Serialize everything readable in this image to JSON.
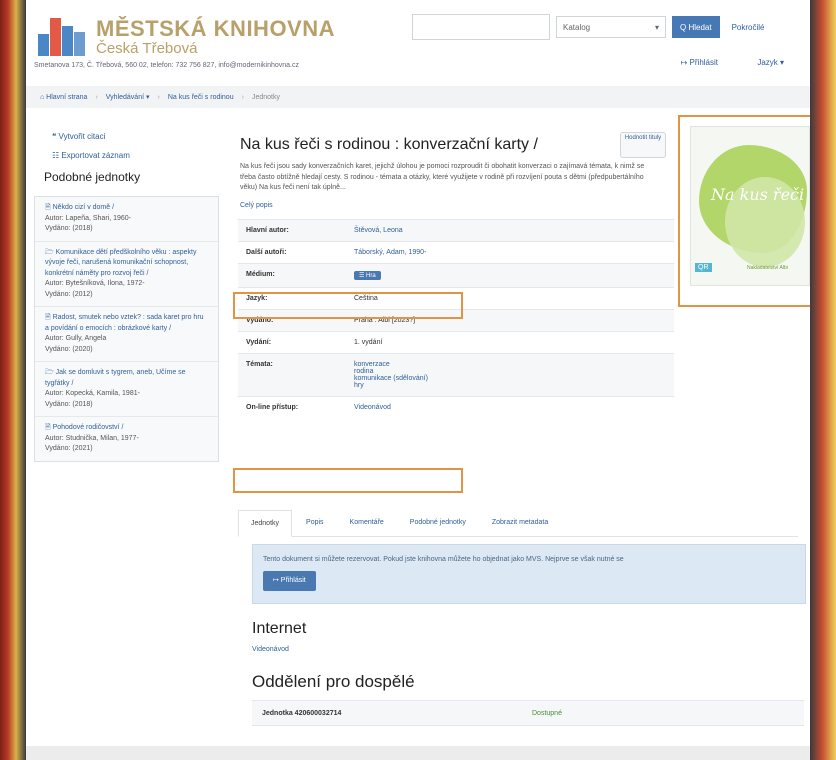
{
  "header": {
    "logo_title": "MĚSTSKÁ KNIHOVNA",
    "logo_subtitle": "Česká Třebová",
    "address": "Smetanova 173, Č. Třebová, 560 02, telefon: 732 756 827, info@modernikinhovna.cz",
    "search_placeholder": "",
    "search_type": "Katalog",
    "search_button": "Q Hledat",
    "advanced_link": "Pokročilé",
    "login_link": "↦ Přihlásit",
    "language_link": "Jazyk ▾"
  },
  "breadcrumb": {
    "home": "⌂ Hlavní strana",
    "search": "Vyhledávání ▾",
    "record": "Na kus řeči s rodinou",
    "current": "Jednotky"
  },
  "left_tools": {
    "cite": "❝ Vytvořit citaci",
    "export": "☷ Exportovat záznam",
    "similar_title": "Podobné jednotky"
  },
  "similar_items": [
    {
      "title": "🗎 Někdo cizí v domě /",
      "author": "Autor: Lapeña, Shari, 1960-",
      "released": "Vydáno: (2018)"
    },
    {
      "title": "🗁 Komunikace dětí předškolního věku : aspekty vývoje řeči, narušená komunikační schopnost, konkrétní náměty pro rozvoj řeči /",
      "author": "Autor: Bytešníková, Ilona, 1972-",
      "released": "Vydáno: (2012)"
    },
    {
      "title": "🗎 Radost, smutek nebo vztek? : sada karet pro hru a povídání o emocích : obrázkové karty /",
      "author": "Autor: Gully, Angela",
      "released": "Vydáno: (2020)"
    },
    {
      "title": "🗁 Jak se domluvit s tygrem, aneb, Učíme se tygřátky /",
      "author": "Autor: Kopecká, Kamila, 1981-",
      "released": "Vydáno: (2018)"
    },
    {
      "title": "🗎 Pohodové rodičovství /",
      "author": "Autor: Studnička, Milan, 1977-",
      "released": "Vydáno: (2021)"
    }
  ],
  "record": {
    "title": "Na kus řeči s rodinou : konverzační karty /",
    "share": "Hodnotit tituly",
    "description": "Na kus řeči jsou sady konverzačních karet, jejichž úlohou je pomoci rozproudit či obohatit konverzaci o zajímavá témata, k nimž se třeba často obtížně hledají cesty. S rodinou - témata a otázky, které využijete v rodině při rozvíjení pouta s dětmi (předpubertálního věku) Na kus řeči není tak úplně...",
    "more": "Celý popis"
  },
  "details": {
    "main_author_label": "Hlavní autor:",
    "main_author": "Štěvová, Leona",
    "other_authors_label": "Další autoři:",
    "other_authors": "Táborský, Adam, 1990-",
    "medium_label": "Médium:",
    "medium": "☰ Hra",
    "language_label": "Jazyk:",
    "language": "Čeština",
    "published_label": "Vydáno:",
    "published": "Praha : Albi [2023?]",
    "edition_label": "Vydání:",
    "edition": "1. vydání",
    "topics_label": "Témata:",
    "topics": [
      "konverzace",
      "rodina",
      "komunikace (sdělování)",
      "hry"
    ],
    "online_label": "On-line přístup:",
    "online": "Videonávod"
  },
  "cover": {
    "title": "Na kus řeči",
    "tag": "QR",
    "footer": "Nakladatelství Albi"
  },
  "tabs": [
    "Jednotky",
    "Popis",
    "Komentáře",
    "Podobné jednotky",
    "Zobrazit metadata"
  ],
  "info_panel": {
    "text": "Tento dokument si můžete rezervovat. Pokud jste knihovna můžete ho objednat jako MVS. Nejprve se však nutné se",
    "login_button": "↦ Přihlásit"
  },
  "internet": {
    "heading": "Internet",
    "link": "Videonávod"
  },
  "department": {
    "heading": "Oddělení pro dospělé",
    "item": "Jednotka 420600032714",
    "status": "Dostupné"
  }
}
